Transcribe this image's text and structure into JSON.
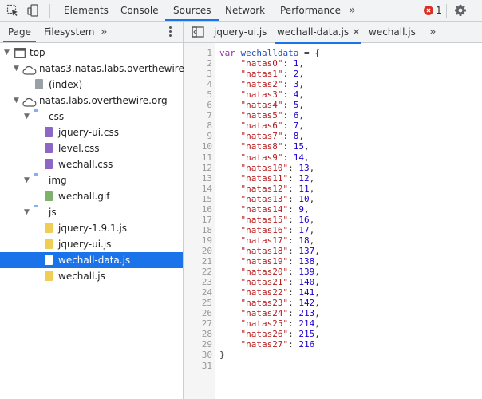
{
  "toolbar": {
    "tabs": [
      "Elements",
      "Console",
      "Sources",
      "Network",
      "Performance"
    ],
    "active_tab": "Sources",
    "more": "»",
    "error_count": "1",
    "icons": [
      "inspect-icon",
      "device-toolbar-icon",
      "settings-icon"
    ]
  },
  "navigator": {
    "tabs": [
      "Page",
      "Filesystem"
    ],
    "active_tab": "Page",
    "more": "»",
    "tree": [
      {
        "label": "top",
        "type": "frame",
        "depth": 0,
        "expanded": true
      },
      {
        "label": "natas3.natas.labs.overthewire.org",
        "type": "cloud",
        "depth": 1,
        "expanded": true
      },
      {
        "label": "(index)",
        "type": "doc",
        "depth": 2
      },
      {
        "label": "natas.labs.overthewire.org",
        "type": "cloud",
        "depth": 1,
        "expanded": true
      },
      {
        "label": "css",
        "type": "folder",
        "depth": 2,
        "expanded": true
      },
      {
        "label": "jquery-ui.css",
        "type": "css",
        "depth": 3
      },
      {
        "label": "level.css",
        "type": "css",
        "depth": 3
      },
      {
        "label": "wechall.css",
        "type": "css",
        "depth": 3
      },
      {
        "label": "img",
        "type": "folder",
        "depth": 2,
        "expanded": true
      },
      {
        "label": "wechall.gif",
        "type": "gif",
        "depth": 3
      },
      {
        "label": "js",
        "type": "folder",
        "depth": 2,
        "expanded": true
      },
      {
        "label": "jquery-1.9.1.js",
        "type": "js",
        "depth": 3
      },
      {
        "label": "jquery-ui.js",
        "type": "js",
        "depth": 3
      },
      {
        "label": "wechall-data.js",
        "type": "js",
        "depth": 3,
        "selected": true
      },
      {
        "label": "wechall.js",
        "type": "js",
        "depth": 3
      }
    ]
  },
  "editor": {
    "tabs": [
      {
        "label": "jquery-ui.js",
        "active": false
      },
      {
        "label": "wechall-data.js",
        "active": true,
        "closable": true
      },
      {
        "label": "wechall.js",
        "active": false
      }
    ],
    "more": "»",
    "code": {
      "decl_keyword": "var",
      "decl_name": "wechalldata",
      "decl_rest": " = {",
      "entries": [
        {
          "key": "\"natas0\"",
          "value": "1"
        },
        {
          "key": "\"natas1\"",
          "value": "2"
        },
        {
          "key": "\"natas2\"",
          "value": "3"
        },
        {
          "key": "\"natas3\"",
          "value": "4"
        },
        {
          "key": "\"natas4\"",
          "value": "5"
        },
        {
          "key": "\"natas5\"",
          "value": "6"
        },
        {
          "key": "\"natas6\"",
          "value": "7"
        },
        {
          "key": "\"natas7\"",
          "value": "8"
        },
        {
          "key": "\"natas8\"",
          "value": "15"
        },
        {
          "key": "\"natas9\"",
          "value": "14"
        },
        {
          "key": "\"natas10\"",
          "value": "13"
        },
        {
          "key": "\"natas11\"",
          "value": "12"
        },
        {
          "key": "\"natas12\"",
          "value": "11"
        },
        {
          "key": "\"natas13\"",
          "value": "10"
        },
        {
          "key": "\"natas14\"",
          "value": "9"
        },
        {
          "key": "\"natas15\"",
          "value": "16"
        },
        {
          "key": "\"natas16\"",
          "value": "17"
        },
        {
          "key": "\"natas17\"",
          "value": "18"
        },
        {
          "key": "\"natas18\"",
          "value": "137"
        },
        {
          "key": "\"natas19\"",
          "value": "138"
        },
        {
          "key": "\"natas20\"",
          "value": "139"
        },
        {
          "key": "\"natas21\"",
          "value": "140"
        },
        {
          "key": "\"natas22\"",
          "value": "141"
        },
        {
          "key": "\"natas23\"",
          "value": "142"
        },
        {
          "key": "\"natas24\"",
          "value": "213"
        },
        {
          "key": "\"natas25\"",
          "value": "214"
        },
        {
          "key": "\"natas26\"",
          "value": "215"
        },
        {
          "key": "\"natas27\"",
          "value": "216"
        }
      ],
      "closing": "}",
      "total_lines": 31
    }
  },
  "colors": {
    "accent": "#1a73e8",
    "toolbar_bg": "#f1f3f4",
    "keyword": "#9b2fb0",
    "string": "#b61c1c",
    "number": "#1c00cf",
    "error": "#d93025"
  }
}
